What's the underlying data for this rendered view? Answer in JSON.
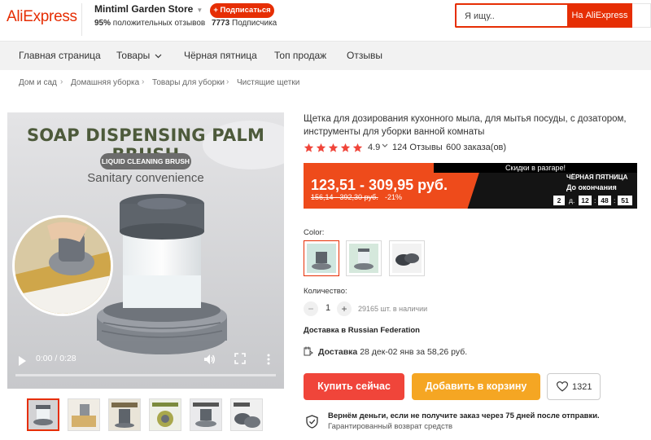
{
  "header": {
    "logo": "AliExpress",
    "store_name": "Mintiml Garden Store",
    "positive_pct": "95%",
    "positive_text": "положительных отзывов",
    "subscribe_label": "+ Подписаться",
    "subscribers_count": "7773",
    "subscribers_text": "Подписчика",
    "search_placeholder": "Я ищу..",
    "search_button": "На AliExpress"
  },
  "nav": {
    "items": [
      "Главная страница",
      "Товары",
      "Чёрная пятница",
      "Топ продаж",
      "Отзывы"
    ]
  },
  "breadcrumb": [
    "Дом и сад",
    "Домашняя уборка",
    "Товары для уборки",
    "Чистящие щетки"
  ],
  "video": {
    "headline": "SOAP DISPENSING PALM BRUSH",
    "pill": "LIQUID CLEANING BRUSH",
    "subtitle": "Sanitary convenience",
    "time": "0:00 / 0:28"
  },
  "product": {
    "title": "Щетка для дозирования кухонного мыла, для мытья посуды, с дозатором, инструменты для уборки ванной комнаты",
    "rating": "4.9",
    "reviews": "124 Отзывы",
    "orders": "600 заказа(ов)",
    "stars": 5
  },
  "price": {
    "banner_top": "Скидки в разгаре!",
    "range": "123,51 - 309,95 руб.",
    "old_range": "156,14 - 392,30 руб.",
    "discount": "-21%",
    "event": "ЧЁРНАЯ ПЯТНИЦА",
    "until": "До окончания",
    "days": "2",
    "days_label": "д.",
    "hours": "12",
    "minutes": "48",
    "seconds": "51",
    "colon": ":"
  },
  "options": {
    "color_label": "Color:",
    "qty_label": "Количество:",
    "qty_minus": "−",
    "qty_value": "1",
    "qty_plus": "+",
    "stock": "29165 шт. в наличии"
  },
  "shipping": {
    "ship_to": "Доставка в Russian Federation",
    "delivery_label": "Доставка",
    "delivery_text": "28 дек-02 янв за 58,26 руб."
  },
  "actions": {
    "buy": "Купить сейчас",
    "cart": "Добавить в корзину",
    "wish_count": "1321"
  },
  "guarantee": {
    "main": "Вернём деньги, если не получите заказ через 75 дней после отправки.",
    "sub": "Гарантированный возврат средств"
  },
  "colors": {
    "brand": "#e62e04",
    "buy": "#f0453a",
    "cart": "#f5a623",
    "star": "#f0453a"
  }
}
